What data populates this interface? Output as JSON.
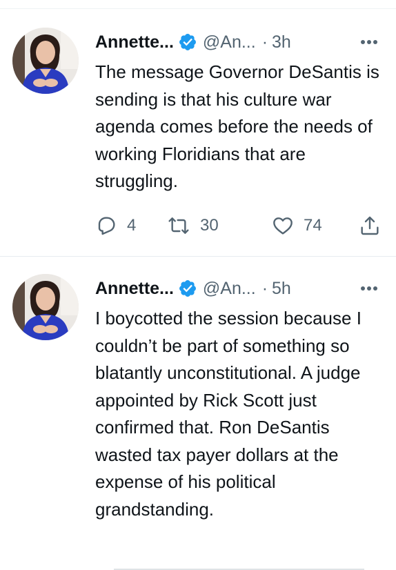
{
  "tweets": [
    {
      "author_name": "Annette...",
      "handle": "@An...",
      "separator": "·",
      "time": "3h",
      "text": "The message Governor DeSantis is sending is that his culture war agenda comes before the needs of working Floridians that are struggling.",
      "replies": "4",
      "retweets": "30",
      "likes": "74"
    },
    {
      "author_name": "Annette...",
      "handle": "@An...",
      "separator": "·",
      "time": "5h",
      "text": "I boycotted the session because I couldn’t be part of something so blatantly unconstitutional. A judge appointed by Rick Scott just confirmed that. Ron DeSantis wasted tax payer dollars at the expense of his political grandstanding."
    }
  ],
  "icons": {
    "verified": "verified-badge-icon",
    "more": "more-horizontal-icon",
    "reply": "reply-icon",
    "retweet": "retweet-icon",
    "like": "heart-icon",
    "share": "share-icon"
  },
  "colors": {
    "verified_blue": "#1d9bf0",
    "secondary_text": "#536471",
    "primary_text": "#0f1419",
    "divider": "#e6ecf0"
  }
}
